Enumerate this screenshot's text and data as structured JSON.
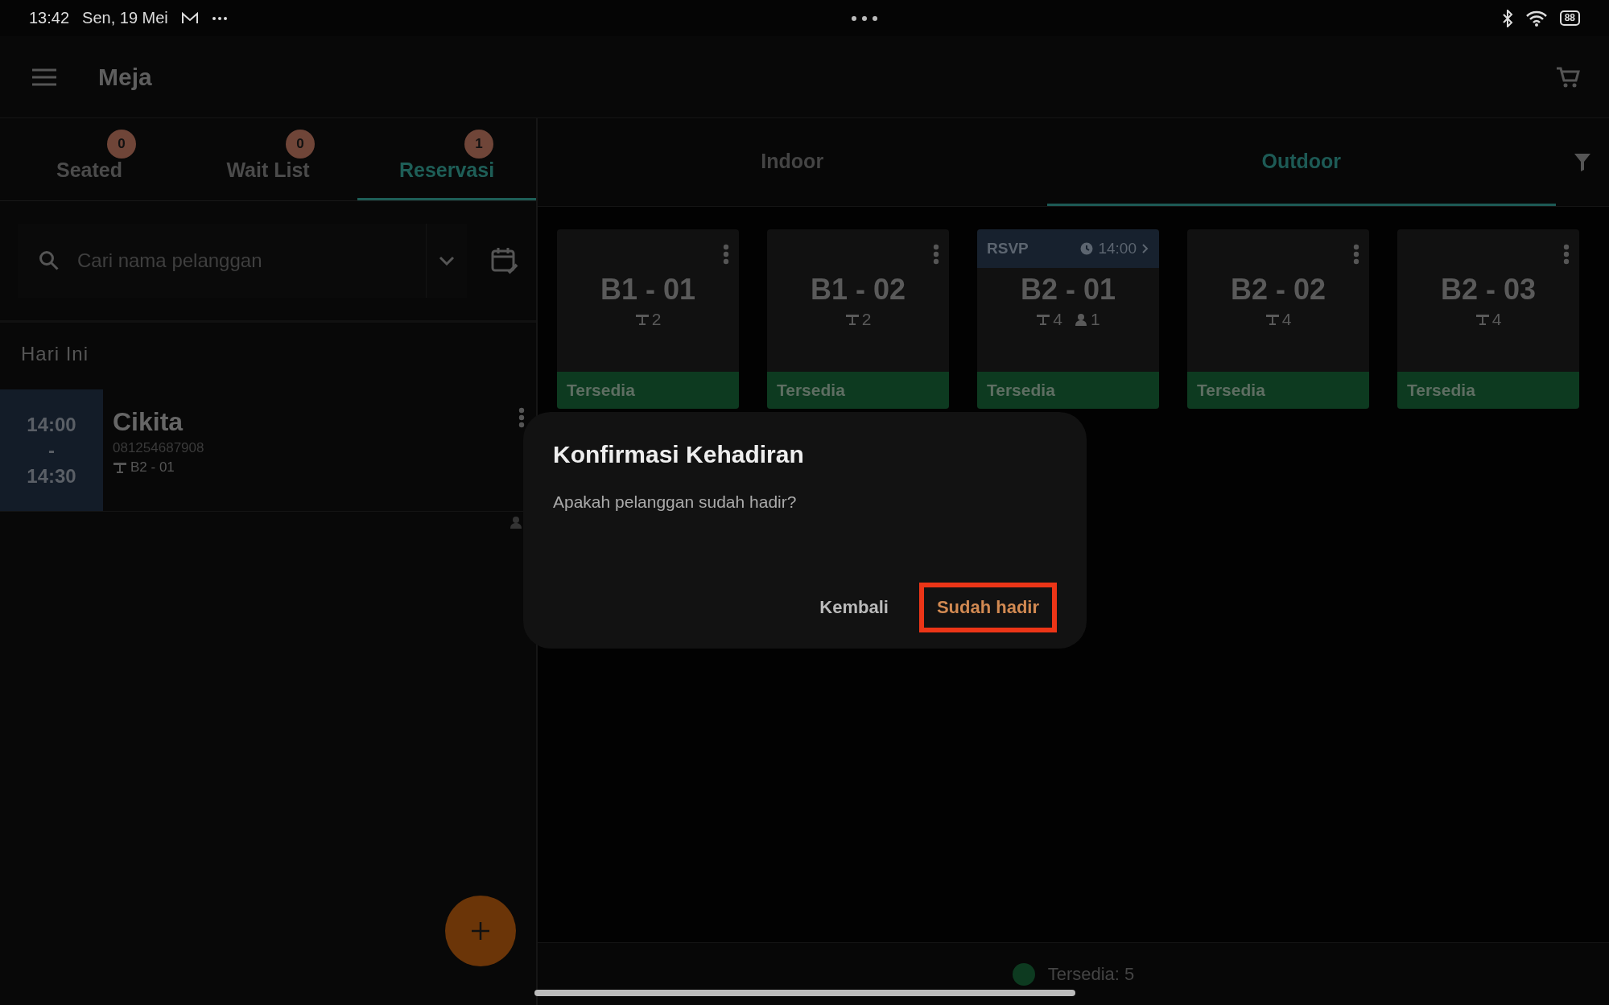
{
  "status_bar": {
    "time": "13:42",
    "date": "Sen, 19 Mei",
    "battery": "88"
  },
  "app_bar": {
    "title": "Meja"
  },
  "list_tabs": [
    {
      "label": "Seated",
      "count": "0",
      "selected": false
    },
    {
      "label": "Wait List",
      "count": "0",
      "selected": false
    },
    {
      "label": "Reservasi",
      "count": "1",
      "selected": true
    }
  ],
  "search": {
    "placeholder": "Cari nama pelanggan"
  },
  "section_title": "Hari Ini",
  "reservations": [
    {
      "start": "14:00",
      "separator": "-",
      "end": "14:30",
      "name": "Cikita",
      "phone": "081254687908",
      "table": "B2 - 01"
    }
  ],
  "area_tabs": [
    {
      "label": "Indoor",
      "selected": false
    },
    {
      "label": "Outdoor",
      "selected": true
    }
  ],
  "tables": [
    {
      "name": "B1 - 01",
      "seats": "2",
      "status": "Tersedia",
      "color": "#0d3a20"
    },
    {
      "name": "B1 - 02",
      "seats": "2",
      "status": "Tersedia",
      "color": "#0d3a20"
    },
    {
      "name": "B2 - 01",
      "seats": "4",
      "guests": "1",
      "rsvp": {
        "label": "RSVP",
        "time": "14:00"
      },
      "status": "Tersedia",
      "color": "#0d3a20"
    },
    {
      "name": "B2 - 02",
      "seats": "4",
      "status": "Tersedia",
      "color": "#0d3a20"
    },
    {
      "name": "B2 - 03",
      "seats": "4",
      "status": "Tersedia",
      "color": "#0d3a20"
    }
  ],
  "legend": [
    {
      "label": "Tersedia: 5",
      "color": "#0d3a20"
    }
  ],
  "dialog": {
    "title": "Konfirmasi Kehadiran",
    "message": "Apakah pelanggan sudah hadir?",
    "buttons": [
      {
        "label": "Kembali",
        "kind": "secondary",
        "highlighted": false
      },
      {
        "label": "Sudah hadir",
        "kind": "primary",
        "highlighted": true
      }
    ]
  }
}
